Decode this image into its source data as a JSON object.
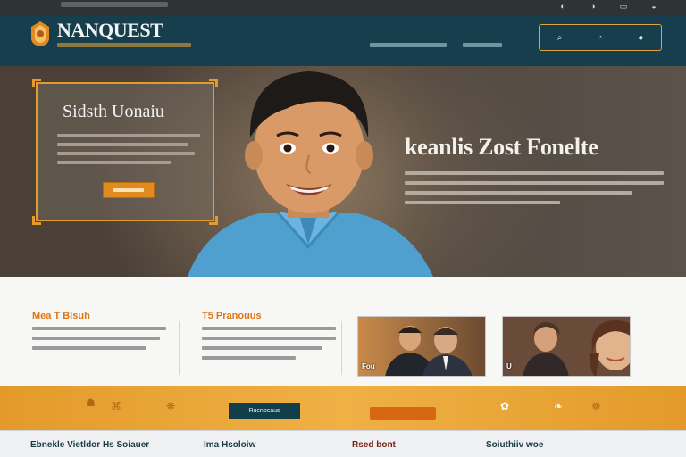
{
  "colors": {
    "header_bg": "#163e4d",
    "accent_orange": "#e49a2f",
    "band": "#f0b045",
    "text_dark": "#1c3a46"
  },
  "header": {
    "brand": "NANQUEST",
    "logo_icon": "shield-lamp-icon",
    "right_box_icons": [
      "search-icon",
      "user-icon",
      "lock-icon"
    ]
  },
  "hero": {
    "card_title": "Sidsth Uonaiu",
    "hero_title": "keanlis Zost Fonelte"
  },
  "sections": {
    "col1_title": "Mea T Blsuh",
    "col2_title": "T5 Pranouus",
    "photo2_caption": "U",
    "photo1_caption": "Fou"
  },
  "band": {
    "button_label": "Rucnocaus"
  },
  "footer": {
    "items": [
      "Ebnekle Vietldor Hs Soiauer",
      "Ima Hsoloiw",
      "Rsed bont",
      "Soiuthiiv woe"
    ]
  }
}
